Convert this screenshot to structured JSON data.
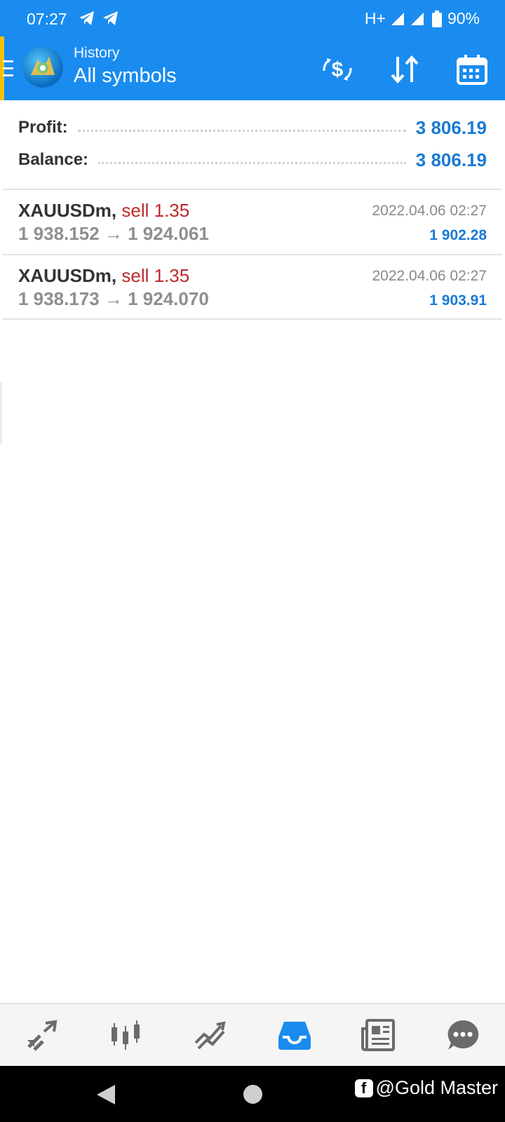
{
  "status_bar": {
    "time": "07:27",
    "network": "H+",
    "battery": "90%",
    "icons": [
      "telegram-icon",
      "telegram-icon",
      "signal-icon",
      "signal-icon",
      "battery-icon"
    ]
  },
  "app_bar": {
    "subtitle": "History",
    "title": "All symbols",
    "actions": [
      "currency-exchange-icon",
      "sort-icon",
      "calendar-icon"
    ],
    "color": "#1a8cf0"
  },
  "summary": {
    "profit_label": "Profit:",
    "profit_value": "3 806.19",
    "balance_label": "Balance:",
    "balance_value": "3 806.19"
  },
  "deals": [
    {
      "symbol": "XAUUSDm,",
      "side": "sell 1.35",
      "prices": "1 938.152 → 1 924.061",
      "time": "2022.04.06 02:27",
      "profit": "1 902.28"
    },
    {
      "symbol": "XAUUSDm,",
      "side": "sell 1.35",
      "prices": "1 938.173 → 1 924.070",
      "time": "2022.04.06 02:27",
      "profit": "1 903.91"
    }
  ],
  "bottom_nav": {
    "items": [
      "quotes-icon",
      "chart-icon",
      "trade-icon",
      "history-icon",
      "news-icon",
      "messages-icon"
    ],
    "active": "history-icon"
  },
  "watermark": {
    "text": "@Gold Master"
  },
  "colors": {
    "accent": "#1a8cf0",
    "profit": "#1a7ad4",
    "sell": "#c0282a"
  }
}
